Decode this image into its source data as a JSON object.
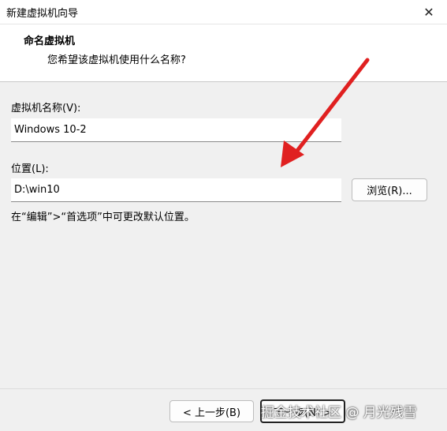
{
  "window": {
    "title": "新建虚拟机向导",
    "close_icon": "close-icon"
  },
  "header": {
    "title": "命名虚拟机",
    "subtitle": "您希望该虚拟机使用什么名称?"
  },
  "form": {
    "name_label": "虚拟机名称(V):",
    "name_value": "Windows 10-2",
    "location_label": "位置(L):",
    "location_value": "D:\\win10",
    "browse_label": "浏览(R)...",
    "hint": "在“编辑”>“首选项”中可更改默认位置。"
  },
  "footer": {
    "back_label": "< 上一步(B)",
    "next_label": "下一步(N) >"
  },
  "watermark": "掘金技术社区 @ 月光残雪",
  "annotation": {
    "arrow_color": "#e02020"
  }
}
